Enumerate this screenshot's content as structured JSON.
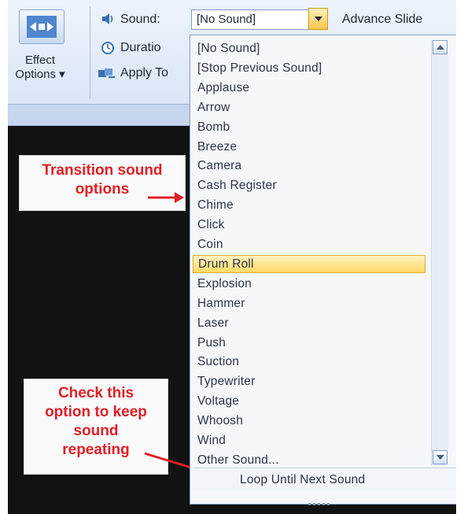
{
  "ribbon": {
    "effect_options_label": "Effect\nOptions ▾",
    "sound_label": "Sound:",
    "sound_value": "[No Sound]",
    "advance_label": "Advance Slide",
    "duration_label": "Duratio",
    "apply_label": "Apply To",
    "right_value": "0"
  },
  "dropdown": {
    "items": [
      "[No Sound]",
      "[Stop Previous Sound]",
      "Applause",
      "Arrow",
      "Bomb",
      "Breeze",
      "Camera",
      "Cash Register",
      "Chime",
      "Click",
      "Coin",
      "Drum Roll",
      "Explosion",
      "Hammer",
      "Laser",
      "Push",
      "Suction",
      "Typewriter",
      "Voltage",
      "Whoosh",
      "Wind",
      "Other Sound..."
    ],
    "selected_item": "Drum Roll",
    "loop_label": "Loop Until Next Sound"
  },
  "callouts": {
    "transition": "Transition sound\noptions",
    "check": "Check this\noption to keep\nsound\nrepeating"
  },
  "colors": {
    "callout_text": "#e01f26",
    "selected_bg": "#ffd966",
    "ribbon_bg": "#d9e6f6"
  }
}
